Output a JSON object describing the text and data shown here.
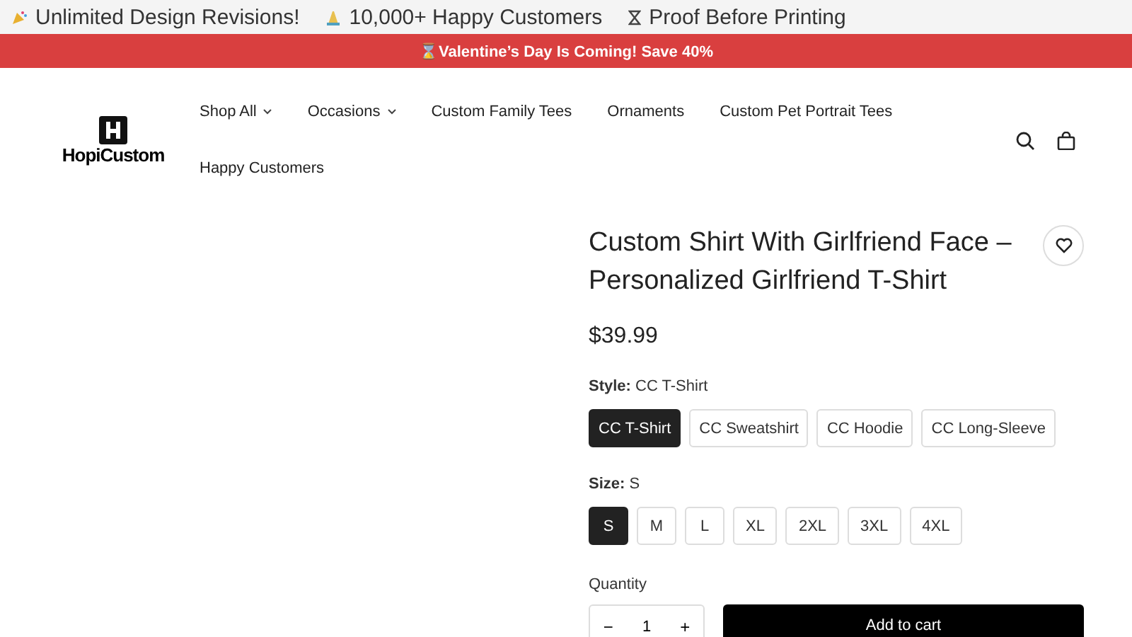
{
  "top_bar": [
    {
      "kind": "party",
      "text": "Unlimited Design Revisions!"
    },
    {
      "kind": "hands",
      "text": "10,000+ Happy Customers"
    },
    {
      "kind": "hourglass",
      "text": "Proof Before Printing"
    }
  ],
  "promo": "⌛Valentine’s Day Is Coming! Save 40%",
  "logo": "HopiCustom",
  "nav": [
    {
      "label": "Shop All",
      "dropdown": true
    },
    {
      "label": "Occasions",
      "dropdown": true
    },
    {
      "label": "Custom Family Tees",
      "dropdown": false
    },
    {
      "label": "Ornaments",
      "dropdown": false
    },
    {
      "label": "Custom Pet Portrait Tees",
      "dropdown": false
    },
    {
      "label": "Happy Customers",
      "dropdown": false
    }
  ],
  "product": {
    "title": "Custom Shirt With Girlfriend Face – Personalized Girlfriend T-Shirt",
    "price": "$39.99",
    "style": {
      "label": "Style:",
      "value": "CC T-Shirt",
      "options": [
        {
          "label": "CC T-Shirt",
          "selected": true
        },
        {
          "label": "CC Sweatshirt",
          "selected": false
        },
        {
          "label": "CC Hoodie",
          "selected": false
        },
        {
          "label": "CC Long-Sleeve",
          "selected": false
        }
      ]
    },
    "size": {
      "label": "Size:",
      "value": "S",
      "options": [
        {
          "label": "S",
          "selected": true
        },
        {
          "label": "M",
          "selected": false
        },
        {
          "label": "L",
          "selected": false
        },
        {
          "label": "XL",
          "selected": false
        },
        {
          "label": "2XL",
          "selected": false
        },
        {
          "label": "3XL",
          "selected": false
        },
        {
          "label": "4XL",
          "selected": false
        }
      ]
    },
    "quantity": {
      "label": "Quantity",
      "minus": "−",
      "value": "1",
      "plus": "+"
    },
    "add_to_cart": "Add to cart"
  }
}
